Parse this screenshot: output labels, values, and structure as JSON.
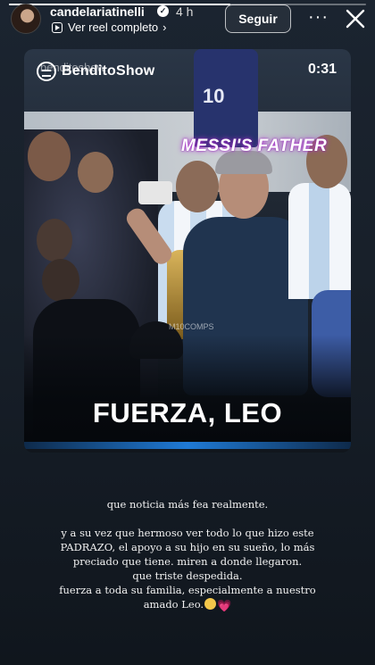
{
  "header": {
    "username": "candelariatinelli",
    "time": "4 h",
    "reel_link": "Ver reel completo",
    "follow_label": "Seguir"
  },
  "progress": 0.62,
  "reel": {
    "brand_name": "BenditoShow",
    "watermark": "benditoshow",
    "duration": "0:31",
    "overlay_caption": "MESSI'S FATHER",
    "credit": "M10COMPS",
    "title": "FUERZA, LEO"
  },
  "caption": {
    "line1": "que noticia más fea realmente.",
    "line2": "y a su vez que hermoso ver todo lo que hizo este",
    "line3": "PADRAZO,  el apoyo a su hijo en su sueño, lo más",
    "line4": "preciado que tiene. miren a donde llegaron.",
    "line5": "que triste despedida.",
    "line6": "fuerza a toda su familia, especialmente a nuestro",
    "line7": "amado Leo.",
    "emoji_face": "pleading-face",
    "emoji_heart": "💗"
  },
  "colors": {
    "background": "#18202a",
    "accent_blue": "#1f7ad6",
    "caption_glow": "#b72fd6"
  }
}
